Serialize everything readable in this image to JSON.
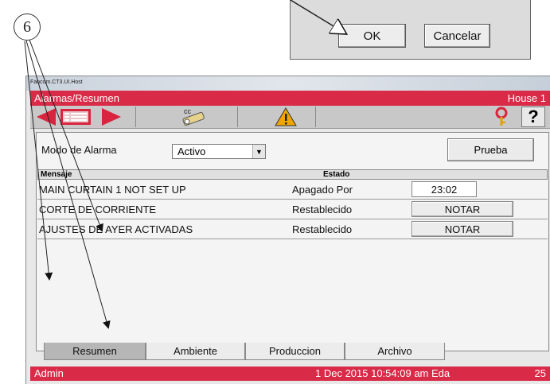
{
  "callout": {
    "number": "6"
  },
  "dialog": {
    "ok_label": "OK",
    "cancel_label": "Cancelar"
  },
  "window": {
    "title": "Fancom.CT3.UI.Host"
  },
  "header": {
    "title": "Alarmas/Resumen",
    "house": "House 1"
  },
  "toolbar": {
    "icons": [
      "arrow-left-icon",
      "list-icon",
      "arrow-right-icon",
      "cc-tool-icon",
      "warning-icon",
      "key-icon",
      "help-icon"
    ],
    "help_label": "?",
    "cc_label": "cc"
  },
  "mode": {
    "label": "Modo de Alarma",
    "value": "Activo",
    "test_button": "Prueba"
  },
  "table": {
    "columns": [
      "Mensaje",
      "Estado"
    ],
    "rows": [
      {
        "message": "MAIN CURTAIN 1 NOT SET UP",
        "status": "Apagado Por",
        "action": "23:02"
      },
      {
        "message": "CORTE DE CORRIENTE",
        "status": "Restablecido",
        "action": "NOTAR"
      },
      {
        "message": "AJUSTES DE AYER ACTIVADAS",
        "status": "Restablecido",
        "action": "NOTAR"
      }
    ]
  },
  "tabs": [
    "Resumen",
    "Ambiente",
    "Produccion",
    "Archivo"
  ],
  "status": {
    "user": "Admin",
    "datetime": "1 Dec 2015  10:54:09 am  Eda",
    "number": "25"
  },
  "colors": {
    "accent": "#d92a47",
    "warning": "#f0a500",
    "arrow": "#d9243d"
  }
}
